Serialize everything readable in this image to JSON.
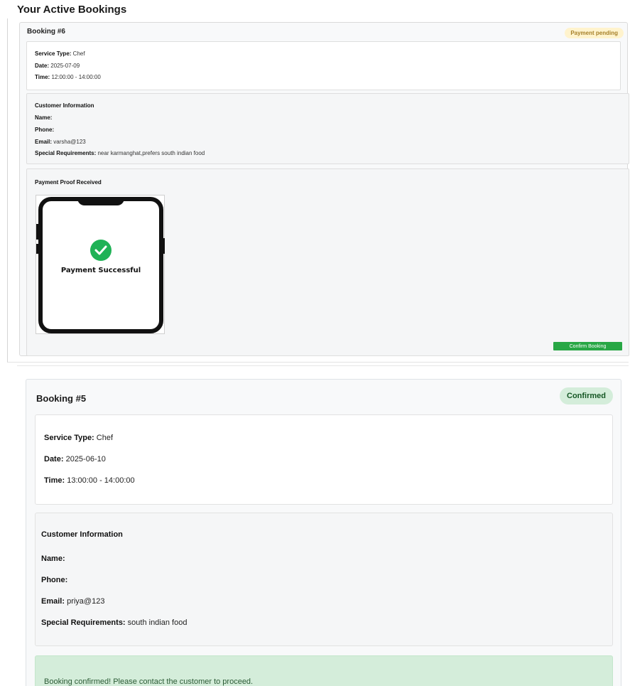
{
  "heading": "Your Active Bookings",
  "bookings": [
    {
      "title": "Booking #6",
      "status": "Payment pending",
      "service_type_label": "Service Type:",
      "service_type": "Chef",
      "date_label": "Date:",
      "date": "2025-07-09",
      "time_label": "Time:",
      "time": "12:00:00 - 14:00:00",
      "customer_heading": "Customer Information",
      "name_label": "Name:",
      "name": "",
      "phone_label": "Phone:",
      "phone": "",
      "email_label": "Email:",
      "email": "varsha@123",
      "requirements_label": "Special Requirements:",
      "requirements": "near karmanghat,prefers south indian food",
      "proof_heading": "Payment Proof Received",
      "proof_image_text": "Payment Successful",
      "confirm_button": "Confirm Booking"
    },
    {
      "title": "Booking #5",
      "status": "Confirmed",
      "service_type_label": "Service Type:",
      "service_type": "Chef",
      "date_label": "Date:",
      "date": "2025-06-10",
      "time_label": "Time:",
      "time": "13:00:00 - 14:00:00",
      "customer_heading": "Customer Information",
      "name_label": "Name:",
      "name": "",
      "phone_label": "Phone:",
      "phone": "",
      "email_label": "Email:",
      "email": "priya@123",
      "requirements_label": "Special Requirements:",
      "requirements": "south indian food",
      "confirmation_message": "Booking confirmed! Please contact the customer to proceed."
    }
  ],
  "colors": {
    "pending_badge_bg": "#fff3cd",
    "confirmed_badge_bg": "#d4edda",
    "confirm_button_bg": "#28a745",
    "success_check": "#1fb256"
  }
}
